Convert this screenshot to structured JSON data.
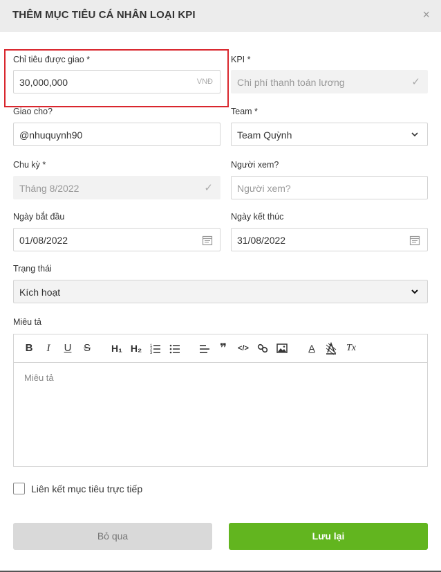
{
  "header": {
    "title": "THÊM MỤC TIÊU CÁ NHÂN LOẠI KPI",
    "close_symbol": "×"
  },
  "form": {
    "target": {
      "label": "Chỉ tiêu được giao *",
      "value": "30,000,000",
      "currency": "VNĐ"
    },
    "kpi": {
      "label": "KPI *",
      "value": "Chi phí thanh toán lương",
      "check": "✓"
    },
    "assignee": {
      "label": "Giao cho?",
      "value": "@nhuquynh90"
    },
    "team": {
      "label": "Team *",
      "value": "Team Quỳnh"
    },
    "cycle": {
      "label": "Chu kỳ *",
      "value": "Tháng 8/2022",
      "check": "✓"
    },
    "viewer": {
      "label": "Người xem?",
      "placeholder": "Người xem?"
    },
    "start_date": {
      "label": "Ngày bắt đầu",
      "value": "01/08/2022"
    },
    "end_date": {
      "label": "Ngày kết thúc",
      "value": "31/08/2022"
    },
    "status": {
      "label": "Trạng thái",
      "value": "Kích hoạt"
    },
    "description": {
      "label": "Miêu tả",
      "placeholder": "Miêu tả"
    }
  },
  "toolbar": {
    "bold": "B",
    "italic": "I",
    "underline": "U",
    "strike": "S",
    "h1": "H₁",
    "h2": "H₂",
    "quote": "❞",
    "code": "</>",
    "font_color": "A",
    "clear_format": "Tx"
  },
  "link_goal": {
    "label": "Liên kết mục tiêu trực tiếp"
  },
  "buttons": {
    "cancel": "Bỏ qua",
    "save": "Lưu lại"
  },
  "colors": {
    "accent": "#62b51f",
    "highlight": "#d9262d",
    "header_bg": "#ececec"
  }
}
